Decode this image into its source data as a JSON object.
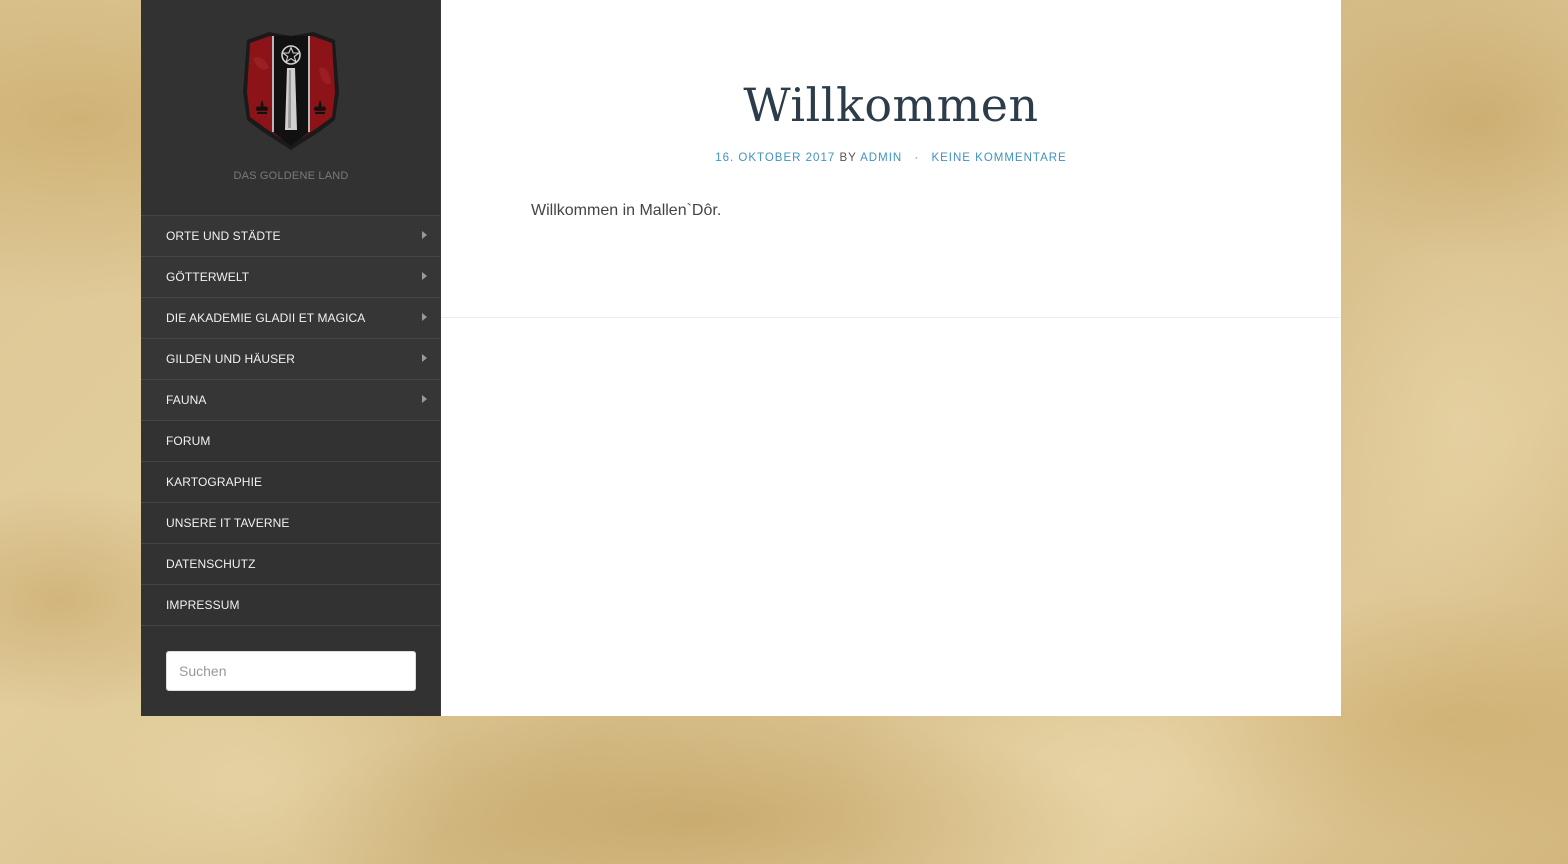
{
  "site": {
    "tagline": "DAS GOLDENE LAND",
    "logo_icon": "coat-of-arms-icon"
  },
  "nav": {
    "items": [
      {
        "label": "ORTE UND STÄDTE",
        "has_children": true
      },
      {
        "label": "GÖTTERWELT",
        "has_children": true
      },
      {
        "label": "DIE AKADEMIE GLADII ET MAGICA",
        "has_children": true
      },
      {
        "label": "GILDEN UND HÄUSER",
        "has_children": true
      },
      {
        "label": "FAUNA",
        "has_children": true
      },
      {
        "label": "FORUM",
        "has_children": false
      },
      {
        "label": "KARTOGRAPHIE",
        "has_children": false
      },
      {
        "label": "UNSERE IT TAVERNE",
        "has_children": false
      },
      {
        "label": "DATENSCHUTZ",
        "has_children": false
      },
      {
        "label": "IMPRESSUM",
        "has_children": false
      }
    ]
  },
  "search": {
    "placeholder": "Suchen",
    "value": ""
  },
  "post": {
    "title": "Willkommen",
    "date": "16. OKTOBER 2017",
    "by": "BY",
    "author": "ADMIN",
    "separator": "·",
    "comments": "KEINE KOMMENTARE",
    "body": "Willkommen in Mallen`Dôr."
  },
  "colors": {
    "sidebar_bg": "#323232",
    "accent_link": "#3f93c2",
    "title": "#2d3c4a",
    "shield_red": "#8c1418"
  }
}
